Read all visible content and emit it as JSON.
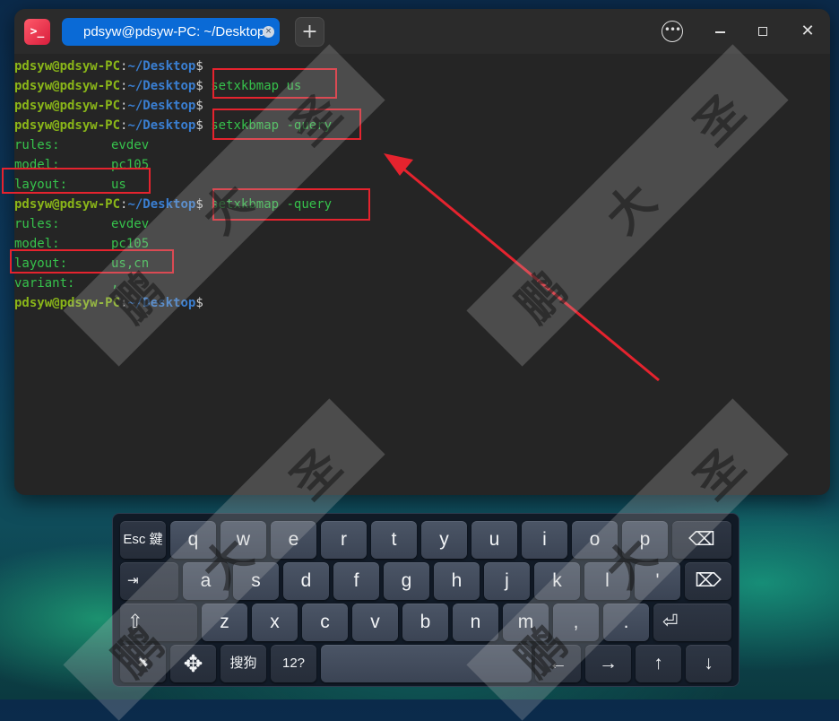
{
  "window": {
    "tab_title": "pdsyw@pdsyw-PC: ~/Desktop",
    "tab_close": "×",
    "new_tab": "+",
    "menu_glyph": "•••",
    "close_glyph": "✕",
    "app_icon_glyph": ">_"
  },
  "prompt": {
    "user": "pdsyw@pdsyw-PC",
    "colon": ":",
    "path": "~/Desktop",
    "dollar": "$"
  },
  "terminal": {
    "commands": [
      "",
      "setxkbmap us",
      "",
      "setxkbmap -query",
      "setxkbmap -query",
      ""
    ],
    "query1": {
      "rules_label": "rules:",
      "rules_value": "evdev",
      "model_label": "model:",
      "model_value": "pc105",
      "layout_label": "layout:",
      "layout_value": "us"
    },
    "query2": {
      "rules_label": "rules:",
      "rules_value": "evdev",
      "model_label": "model:",
      "model_value": "pc105",
      "layout_label": "layout:",
      "layout_value": "us,cn",
      "variant_label": "variant:",
      "variant_value": ","
    }
  },
  "keyboard": {
    "row1": [
      "Esc 鍵",
      "q",
      "w",
      "e",
      "r",
      "t",
      "y",
      "u",
      "i",
      "o",
      "p",
      "⌫"
    ],
    "row2": [
      "⇥",
      "a",
      "s",
      "d",
      "f",
      "g",
      "h",
      "j",
      "k",
      "l",
      "'",
      "⌦"
    ],
    "row3": [
      "⇧",
      "z",
      "x",
      "c",
      "v",
      "b",
      "n",
      "m",
      ",",
      ".",
      "⏎"
    ],
    "row4": [
      "✖",
      "✥",
      "搜狗",
      "12?",
      "",
      "←",
      "→",
      "↑",
      "↓"
    ]
  },
  "watermark": {
    "chars": [
      "鹏",
      "大",
      "圣"
    ]
  },
  "colors": {
    "highlight": "#e5232e",
    "tab_active": "#0a6ad6",
    "prompt_user": "#8ab619",
    "prompt_path": "#3a7fd2",
    "output": "#36c24c"
  }
}
